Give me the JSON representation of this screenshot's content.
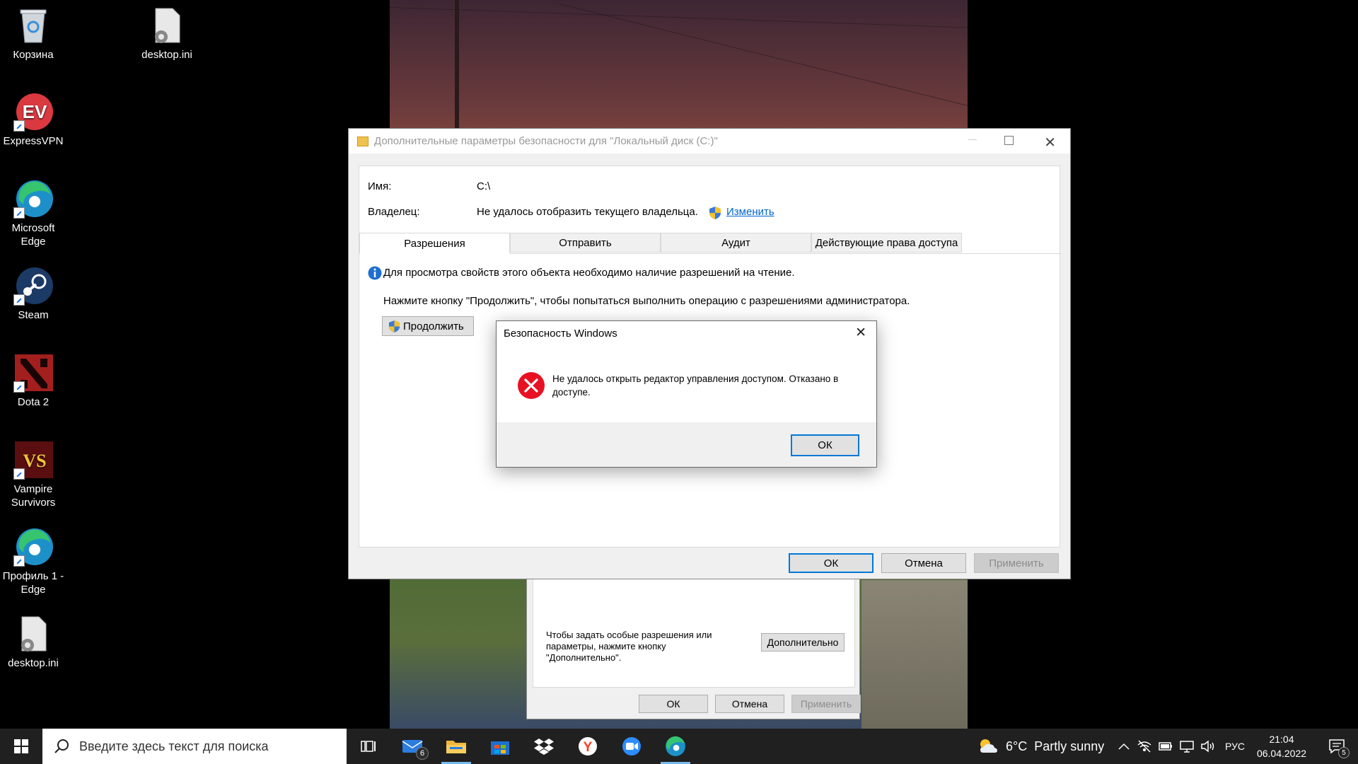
{
  "desktop": {
    "icons": [
      {
        "label": "Корзина"
      },
      {
        "label": "desktop.ini"
      },
      {
        "label": "ExpressVPN"
      },
      {
        "label": "Microsoft Edge"
      },
      {
        "label": "Steam"
      },
      {
        "label": "Dota 2"
      },
      {
        "label": "Vampire Survivors"
      },
      {
        "label": "Профиль 1 - Edge"
      },
      {
        "label": "desktop.ini"
      }
    ]
  },
  "props_window": {
    "special_text": "Чтобы задать особые разрешения или параметры, нажмите кнопку \"Дополнительно\".",
    "advanced_button": "Дополнительно",
    "ok": "ОК",
    "cancel": "Отмена",
    "apply": "Применить"
  },
  "adv_window": {
    "title": "Дополнительные параметры безопасности  для \"Локальный диск (C:)\"",
    "name_label": "Имя:",
    "name_value": "C:\\",
    "owner_label": "Владелец:",
    "owner_value": "Не удалось отобразить текущего владельца.",
    "change_link": "Изменить",
    "tabs": [
      "Разрешения",
      "Отправить",
      "Аудит",
      "Действующие права доступа"
    ],
    "info_text": "Для просмотра свойств этого объекта необходимо наличие разрешений на чтение.",
    "continue_hint": "Нажмите кнопку \"Продолжить\", чтобы попытаться выполнить операцию с разрешениями администратора.",
    "continue_button": "Продолжить",
    "ok": "ОК",
    "cancel": "Отмена",
    "apply": "Применить"
  },
  "error_dialog": {
    "title": "Безопасность Windows",
    "message": "Не удалось открыть редактор управления доступом. Отказано в доступе.",
    "ok": "ОК"
  },
  "taskbar": {
    "search_placeholder": "Введите здесь текст для поиска",
    "mail_badge": "6",
    "weather": "6°C  Partly sunny",
    "lang": "РУС",
    "time": "21:04",
    "date": "06.04.2022",
    "notif_badge": "5"
  },
  "colors": {
    "accent": "#0078d7",
    "link": "#0066cc",
    "error": "#e81123",
    "taskbar": "#202020"
  }
}
